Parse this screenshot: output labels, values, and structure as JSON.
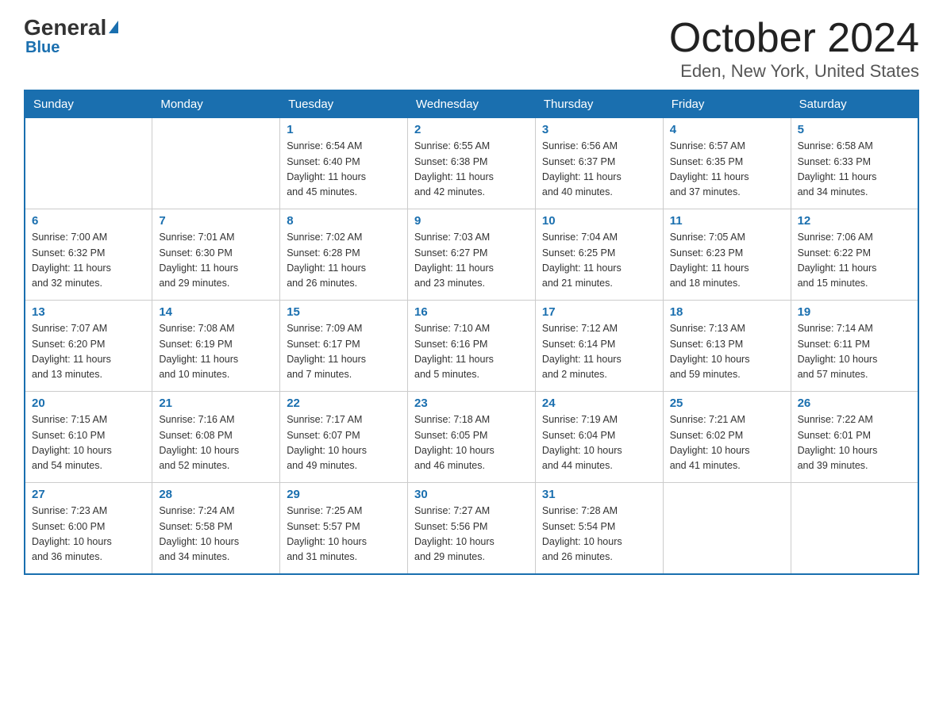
{
  "header": {
    "logo_general": "General",
    "logo_triangle": "▶",
    "logo_blue": "Blue",
    "title": "October 2024",
    "subtitle": "Eden, New York, United States"
  },
  "columns": [
    "Sunday",
    "Monday",
    "Tuesday",
    "Wednesday",
    "Thursday",
    "Friday",
    "Saturday"
  ],
  "weeks": [
    [
      {
        "day": "",
        "info": ""
      },
      {
        "day": "",
        "info": ""
      },
      {
        "day": "1",
        "info": "Sunrise: 6:54 AM\nSunset: 6:40 PM\nDaylight: 11 hours\nand 45 minutes."
      },
      {
        "day": "2",
        "info": "Sunrise: 6:55 AM\nSunset: 6:38 PM\nDaylight: 11 hours\nand 42 minutes."
      },
      {
        "day": "3",
        "info": "Sunrise: 6:56 AM\nSunset: 6:37 PM\nDaylight: 11 hours\nand 40 minutes."
      },
      {
        "day": "4",
        "info": "Sunrise: 6:57 AM\nSunset: 6:35 PM\nDaylight: 11 hours\nand 37 minutes."
      },
      {
        "day": "5",
        "info": "Sunrise: 6:58 AM\nSunset: 6:33 PM\nDaylight: 11 hours\nand 34 minutes."
      }
    ],
    [
      {
        "day": "6",
        "info": "Sunrise: 7:00 AM\nSunset: 6:32 PM\nDaylight: 11 hours\nand 32 minutes."
      },
      {
        "day": "7",
        "info": "Sunrise: 7:01 AM\nSunset: 6:30 PM\nDaylight: 11 hours\nand 29 minutes."
      },
      {
        "day": "8",
        "info": "Sunrise: 7:02 AM\nSunset: 6:28 PM\nDaylight: 11 hours\nand 26 minutes."
      },
      {
        "day": "9",
        "info": "Sunrise: 7:03 AM\nSunset: 6:27 PM\nDaylight: 11 hours\nand 23 minutes."
      },
      {
        "day": "10",
        "info": "Sunrise: 7:04 AM\nSunset: 6:25 PM\nDaylight: 11 hours\nand 21 minutes."
      },
      {
        "day": "11",
        "info": "Sunrise: 7:05 AM\nSunset: 6:23 PM\nDaylight: 11 hours\nand 18 minutes."
      },
      {
        "day": "12",
        "info": "Sunrise: 7:06 AM\nSunset: 6:22 PM\nDaylight: 11 hours\nand 15 minutes."
      }
    ],
    [
      {
        "day": "13",
        "info": "Sunrise: 7:07 AM\nSunset: 6:20 PM\nDaylight: 11 hours\nand 13 minutes."
      },
      {
        "day": "14",
        "info": "Sunrise: 7:08 AM\nSunset: 6:19 PM\nDaylight: 11 hours\nand 10 minutes."
      },
      {
        "day": "15",
        "info": "Sunrise: 7:09 AM\nSunset: 6:17 PM\nDaylight: 11 hours\nand 7 minutes."
      },
      {
        "day": "16",
        "info": "Sunrise: 7:10 AM\nSunset: 6:16 PM\nDaylight: 11 hours\nand 5 minutes."
      },
      {
        "day": "17",
        "info": "Sunrise: 7:12 AM\nSunset: 6:14 PM\nDaylight: 11 hours\nand 2 minutes."
      },
      {
        "day": "18",
        "info": "Sunrise: 7:13 AM\nSunset: 6:13 PM\nDaylight: 10 hours\nand 59 minutes."
      },
      {
        "day": "19",
        "info": "Sunrise: 7:14 AM\nSunset: 6:11 PM\nDaylight: 10 hours\nand 57 minutes."
      }
    ],
    [
      {
        "day": "20",
        "info": "Sunrise: 7:15 AM\nSunset: 6:10 PM\nDaylight: 10 hours\nand 54 minutes."
      },
      {
        "day": "21",
        "info": "Sunrise: 7:16 AM\nSunset: 6:08 PM\nDaylight: 10 hours\nand 52 minutes."
      },
      {
        "day": "22",
        "info": "Sunrise: 7:17 AM\nSunset: 6:07 PM\nDaylight: 10 hours\nand 49 minutes."
      },
      {
        "day": "23",
        "info": "Sunrise: 7:18 AM\nSunset: 6:05 PM\nDaylight: 10 hours\nand 46 minutes."
      },
      {
        "day": "24",
        "info": "Sunrise: 7:19 AM\nSunset: 6:04 PM\nDaylight: 10 hours\nand 44 minutes."
      },
      {
        "day": "25",
        "info": "Sunrise: 7:21 AM\nSunset: 6:02 PM\nDaylight: 10 hours\nand 41 minutes."
      },
      {
        "day": "26",
        "info": "Sunrise: 7:22 AM\nSunset: 6:01 PM\nDaylight: 10 hours\nand 39 minutes."
      }
    ],
    [
      {
        "day": "27",
        "info": "Sunrise: 7:23 AM\nSunset: 6:00 PM\nDaylight: 10 hours\nand 36 minutes."
      },
      {
        "day": "28",
        "info": "Sunrise: 7:24 AM\nSunset: 5:58 PM\nDaylight: 10 hours\nand 34 minutes."
      },
      {
        "day": "29",
        "info": "Sunrise: 7:25 AM\nSunset: 5:57 PM\nDaylight: 10 hours\nand 31 minutes."
      },
      {
        "day": "30",
        "info": "Sunrise: 7:27 AM\nSunset: 5:56 PM\nDaylight: 10 hours\nand 29 minutes."
      },
      {
        "day": "31",
        "info": "Sunrise: 7:28 AM\nSunset: 5:54 PM\nDaylight: 10 hours\nand 26 minutes."
      },
      {
        "day": "",
        "info": ""
      },
      {
        "day": "",
        "info": ""
      }
    ]
  ]
}
